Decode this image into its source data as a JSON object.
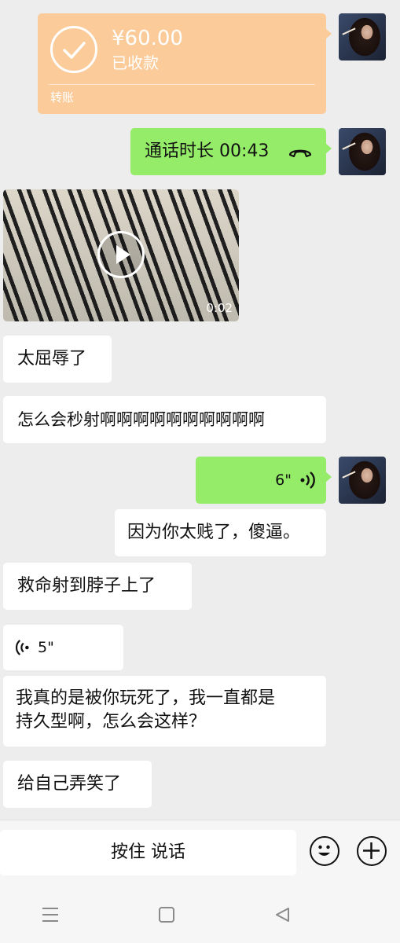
{
  "transfer": {
    "amount": "¥60.00",
    "status": "已收款",
    "type": "转账"
  },
  "call": {
    "label": "通话时长 00:43"
  },
  "video": {
    "duration": "0:02"
  },
  "messages": {
    "m1": "太屈辱了",
    "m2": "怎么会秒射啊啊啊啊啊啊啊啊啊啊",
    "voice_sent": "6\"",
    "m3": "因为你太贱了，傻逼。",
    "m4": "救命射到脖子上了",
    "voice_recv": "5\"",
    "m5_line1": "我真的是被你玩死了，我一直都是",
    "m5_line2": "持久型啊，怎么会这样？",
    "m6": "给自己弄笑了"
  },
  "input": {
    "hold_to_talk": "按住 说话"
  },
  "icons": [
    "check-icon",
    "phone-hangup-icon",
    "play-icon",
    "voice-wave-icon",
    "emoji-icon",
    "plus-icon",
    "menu-icon",
    "home-icon",
    "back-icon"
  ],
  "colors": {
    "background": "#ededed",
    "sent_bubble": "#95ec69",
    "transfer_card": "#fbcb99"
  }
}
